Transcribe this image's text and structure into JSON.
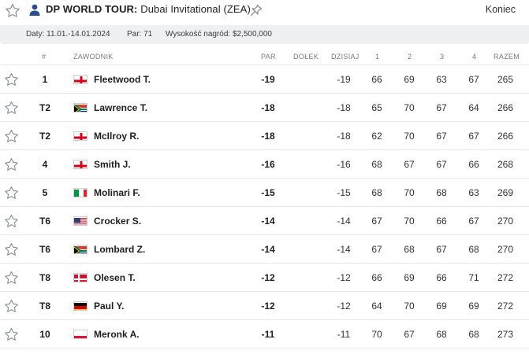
{
  "header": {
    "tour": "DP WORLD TOUR:",
    "event": "Dubai Invitational (ZEA)",
    "status": "Koniec",
    "icons": [
      "star-icon",
      "person-icon",
      "pin-icon"
    ]
  },
  "info": {
    "dates": "Daty: 11.01.-14.01.2024",
    "par": "Par: 71",
    "prize": "Wysokość nagród: $2,500,000"
  },
  "columns": {
    "rank": "#",
    "player": "ZAWODNIK",
    "par": "PAR",
    "thru": "DOŁEK",
    "today": "DZISIAJ",
    "r1": "1",
    "r2": "2",
    "r3": "3",
    "r4": "4",
    "total": "RAZEM"
  },
  "rows": [
    {
      "pos": "1",
      "flag": "england",
      "name": "Fleetwood T.",
      "par": "-19",
      "thru": "",
      "today": "-19",
      "r1": "66",
      "r2": "69",
      "r3": "63",
      "r4": "67",
      "total": "265"
    },
    {
      "pos": "T2",
      "flag": "south-africa",
      "name": "Lawrence T.",
      "par": "-18",
      "thru": "",
      "today": "-18",
      "r1": "65",
      "r2": "70",
      "r3": "67",
      "r4": "64",
      "total": "266"
    },
    {
      "pos": "T2",
      "flag": "england",
      "name": "McIlroy R.",
      "par": "-18",
      "thru": "",
      "today": "-18",
      "r1": "62",
      "r2": "70",
      "r3": "67",
      "r4": "67",
      "total": "266"
    },
    {
      "pos": "4",
      "flag": "england",
      "name": "Smith J.",
      "par": "-16",
      "thru": "",
      "today": "-16",
      "r1": "68",
      "r2": "67",
      "r3": "67",
      "r4": "66",
      "total": "268"
    },
    {
      "pos": "5",
      "flag": "italy",
      "name": "Molinari F.",
      "par": "-15",
      "thru": "",
      "today": "-15",
      "r1": "68",
      "r2": "70",
      "r3": "68",
      "r4": "63",
      "total": "269"
    },
    {
      "pos": "T6",
      "flag": "usa",
      "name": "Crocker S.",
      "par": "-14",
      "thru": "",
      "today": "-14",
      "r1": "67",
      "r2": "70",
      "r3": "66",
      "r4": "67",
      "total": "270"
    },
    {
      "pos": "T6",
      "flag": "south-africa",
      "name": "Lombard Z.",
      "par": "-14",
      "thru": "",
      "today": "-14",
      "r1": "67",
      "r2": "68",
      "r3": "67",
      "r4": "68",
      "total": "270"
    },
    {
      "pos": "T8",
      "flag": "denmark",
      "name": "Olesen T.",
      "par": "-12",
      "thru": "",
      "today": "-12",
      "r1": "66",
      "r2": "69",
      "r3": "66",
      "r4": "71",
      "total": "272"
    },
    {
      "pos": "T8",
      "flag": "germany",
      "name": "Paul Y.",
      "par": "-12",
      "thru": "",
      "today": "-12",
      "r1": "64",
      "r2": "70",
      "r3": "69",
      "r4": "69",
      "total": "272"
    },
    {
      "pos": "10",
      "flag": "poland",
      "name": "Meronk A.",
      "par": "-11",
      "thru": "",
      "today": "-11",
      "r1": "70",
      "r2": "67",
      "r3": "68",
      "r4": "68",
      "total": "273"
    }
  ]
}
